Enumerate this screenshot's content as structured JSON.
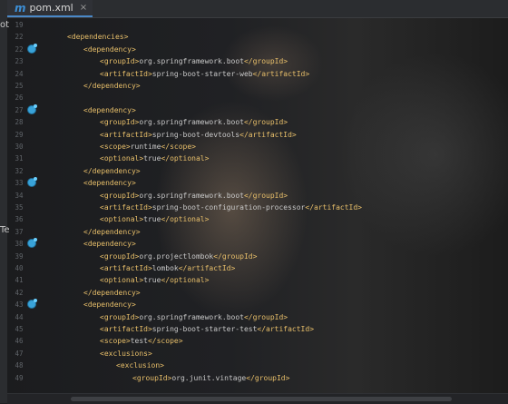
{
  "tab": {
    "icon": "maven-m-icon",
    "icon_glyph": "m",
    "label": "pom.xml",
    "close": "×"
  },
  "left_strip": {
    "top_text": "ot",
    "mid_text": "Te"
  },
  "lines": [
    {
      "n": "19",
      "indent": 0,
      "parts": []
    },
    {
      "n": "22",
      "indent": 0,
      "parts": [
        {
          "t": "tag",
          "v": "<dependencies>"
        }
      ]
    },
    {
      "n": "22",
      "indent": 1,
      "icon": true,
      "parts": [
        {
          "t": "tag",
          "v": "<dependency>"
        }
      ]
    },
    {
      "n": "23",
      "indent": 2,
      "parts": [
        {
          "t": "tag",
          "v": "<groupId>"
        },
        {
          "t": "txt",
          "v": "org.springframework.boot"
        },
        {
          "t": "tag",
          "v": "</groupId>"
        }
      ]
    },
    {
      "n": "24",
      "indent": 2,
      "parts": [
        {
          "t": "tag",
          "v": "<artifactId>"
        },
        {
          "t": "txt",
          "v": "spring-boot-starter-web"
        },
        {
          "t": "tag",
          "v": "</artifactId>"
        }
      ]
    },
    {
      "n": "25",
      "indent": 1,
      "parts": [
        {
          "t": "tag",
          "v": "</dependency>"
        }
      ]
    },
    {
      "n": "26",
      "indent": 0,
      "parts": []
    },
    {
      "n": "27",
      "indent": 1,
      "icon": true,
      "parts": [
        {
          "t": "tag",
          "v": "<dependency>"
        }
      ]
    },
    {
      "n": "28",
      "indent": 2,
      "parts": [
        {
          "t": "tag",
          "v": "<groupId>"
        },
        {
          "t": "txt",
          "v": "org.springframework.boot"
        },
        {
          "t": "tag",
          "v": "</groupId>"
        }
      ]
    },
    {
      "n": "29",
      "indent": 2,
      "parts": [
        {
          "t": "tag",
          "v": "<artifactId>"
        },
        {
          "t": "txt",
          "v": "spring-boot-devtools"
        },
        {
          "t": "tag",
          "v": "</artifactId>"
        }
      ]
    },
    {
      "n": "30",
      "indent": 2,
      "parts": [
        {
          "t": "tag",
          "v": "<scope>"
        },
        {
          "t": "txt",
          "v": "runtime"
        },
        {
          "t": "tag",
          "v": "</scope>"
        }
      ]
    },
    {
      "n": "31",
      "indent": 2,
      "parts": [
        {
          "t": "tag",
          "v": "<optional>"
        },
        {
          "t": "txt",
          "v": "true"
        },
        {
          "t": "tag",
          "v": "</optional>"
        }
      ]
    },
    {
      "n": "32",
      "indent": 1,
      "parts": [
        {
          "t": "tag",
          "v": "</dependency>"
        }
      ]
    },
    {
      "n": "33",
      "indent": 1,
      "icon": true,
      "parts": [
        {
          "t": "tag",
          "v": "<dependency>"
        }
      ]
    },
    {
      "n": "34",
      "indent": 2,
      "parts": [
        {
          "t": "tag",
          "v": "<groupId>"
        },
        {
          "t": "txt",
          "v": "org.springframework.boot"
        },
        {
          "t": "tag",
          "v": "</groupId>"
        }
      ]
    },
    {
      "n": "35",
      "indent": 2,
      "parts": [
        {
          "t": "tag",
          "v": "<artifactId>"
        },
        {
          "t": "txt",
          "v": "spring-boot-configuration-processor"
        },
        {
          "t": "tag",
          "v": "</artifactId>"
        }
      ]
    },
    {
      "n": "36",
      "indent": 2,
      "parts": [
        {
          "t": "tag",
          "v": "<optional>"
        },
        {
          "t": "txt",
          "v": "true"
        },
        {
          "t": "tag",
          "v": "</optional>"
        }
      ]
    },
    {
      "n": "37",
      "indent": 1,
      "parts": [
        {
          "t": "tag",
          "v": "</dependency>"
        }
      ]
    },
    {
      "n": "38",
      "indent": 1,
      "icon": true,
      "parts": [
        {
          "t": "tag",
          "v": "<dependency>"
        }
      ]
    },
    {
      "n": "39",
      "indent": 2,
      "parts": [
        {
          "t": "tag",
          "v": "<groupId>"
        },
        {
          "t": "txt",
          "v": "org.projectlombok"
        },
        {
          "t": "tag",
          "v": "</groupId>"
        }
      ]
    },
    {
      "n": "40",
      "indent": 2,
      "parts": [
        {
          "t": "tag",
          "v": "<artifactId>"
        },
        {
          "t": "txt",
          "v": "lombok"
        },
        {
          "t": "tag",
          "v": "</artifactId>"
        }
      ]
    },
    {
      "n": "41",
      "indent": 2,
      "parts": [
        {
          "t": "tag",
          "v": "<optional>"
        },
        {
          "t": "txt",
          "v": "true"
        },
        {
          "t": "tag",
          "v": "</optional>"
        }
      ]
    },
    {
      "n": "42",
      "indent": 1,
      "parts": [
        {
          "t": "tag",
          "v": "</dependency>"
        }
      ]
    },
    {
      "n": "43",
      "indent": 1,
      "icon": true,
      "parts": [
        {
          "t": "tag",
          "v": "<dependency>"
        }
      ]
    },
    {
      "n": "44",
      "indent": 2,
      "parts": [
        {
          "t": "tag",
          "v": "<groupId>"
        },
        {
          "t": "txt",
          "v": "org.springframework.boot"
        },
        {
          "t": "tag",
          "v": "</groupId>"
        }
      ]
    },
    {
      "n": "45",
      "indent": 2,
      "parts": [
        {
          "t": "tag",
          "v": "<artifactId>"
        },
        {
          "t": "txt",
          "v": "spring-boot-starter-test"
        },
        {
          "t": "tag",
          "v": "</artifactId>"
        }
      ]
    },
    {
      "n": "46",
      "indent": 2,
      "parts": [
        {
          "t": "tag",
          "v": "<scope>"
        },
        {
          "t": "txt",
          "v": "test"
        },
        {
          "t": "tag",
          "v": "</scope>"
        }
      ]
    },
    {
      "n": "47",
      "indent": 2,
      "parts": [
        {
          "t": "tag",
          "v": "<exclusions>"
        }
      ]
    },
    {
      "n": "48",
      "indent": 3,
      "parts": [
        {
          "t": "tag",
          "v": "<exclusion>"
        }
      ]
    },
    {
      "n": "49",
      "indent": 4,
      "parts": [
        {
          "t": "tag",
          "v": "<groupId>"
        },
        {
          "t": "txt",
          "v": "org.junit.vintage"
        },
        {
          "t": "tag",
          "v": "</groupId>"
        }
      ]
    }
  ],
  "colors": {
    "tag": "#e8bf6a",
    "text": "#c8c8c8",
    "line_number": "#5f6368",
    "gutter_icon": "#39a3d9",
    "tab_accent": "#4a88c7"
  }
}
